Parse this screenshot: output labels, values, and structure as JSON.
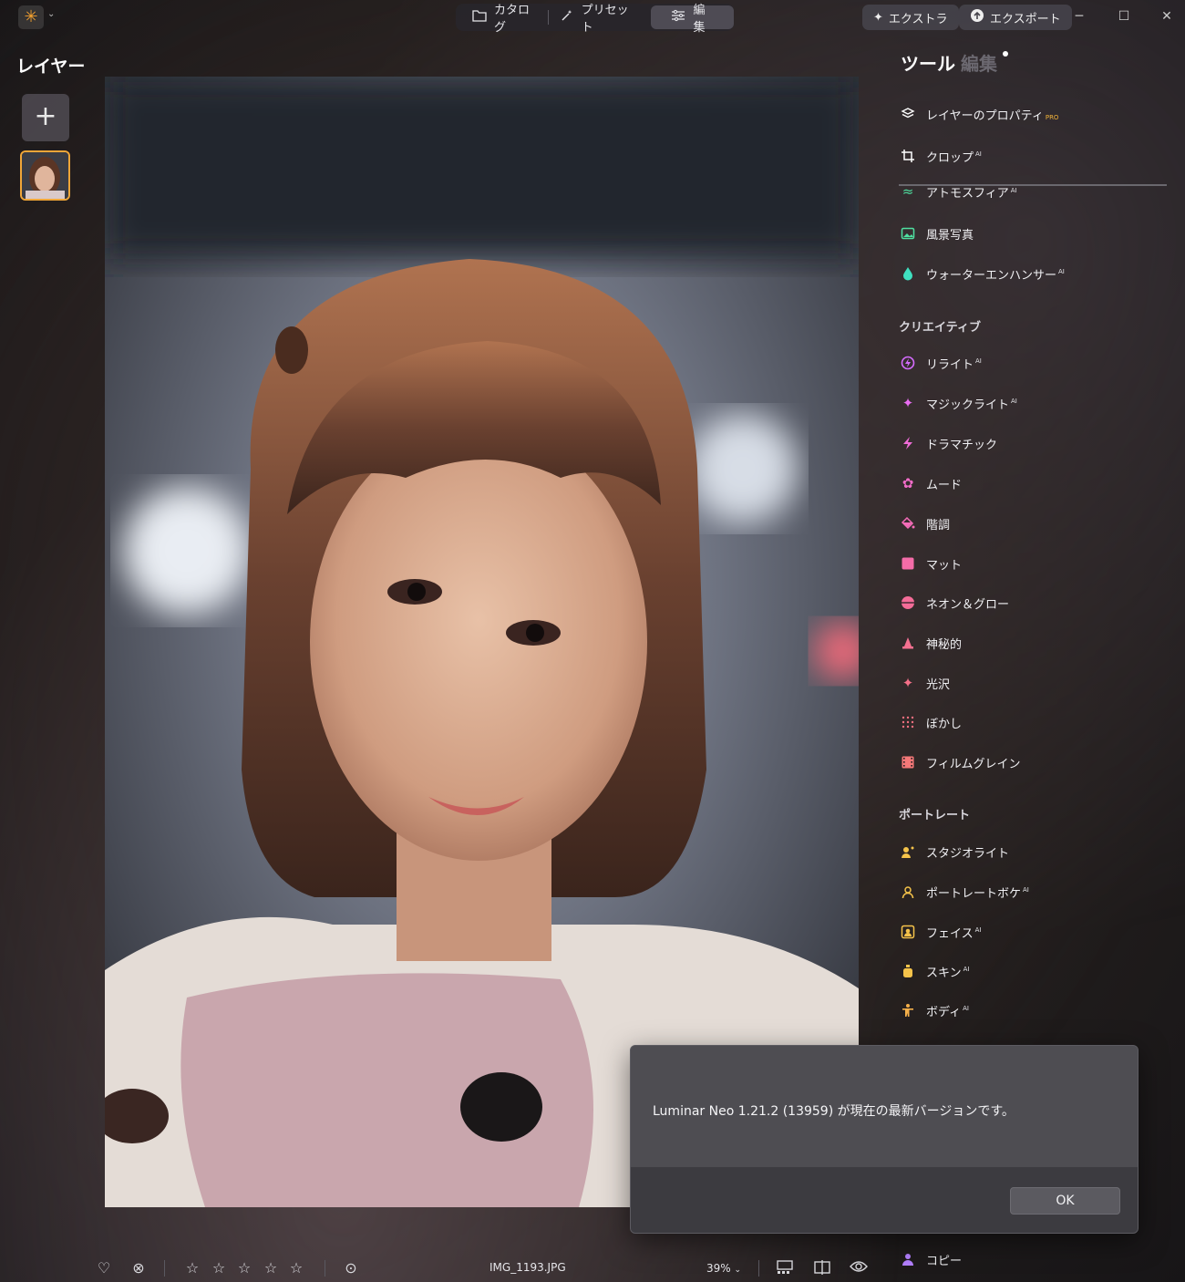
{
  "titlebar": {
    "modes": [
      {
        "label": "カタログ",
        "icon": "folder-icon"
      },
      {
        "label": "プリセット",
        "icon": "sparkle-wand-icon"
      },
      {
        "label": "編集",
        "icon": "sliders-icon",
        "active": true
      }
    ],
    "extras_label": "エクストラ",
    "export_label": "エクスポート"
  },
  "layers": {
    "title": "レイヤー",
    "add_symbol": "+"
  },
  "panel": {
    "tab_tools": "ツール",
    "tab_edits": "編集",
    "top_items": [
      {
        "label": "レイヤーのプロパティ",
        "badge": "PRO",
        "icon": "layers-icon",
        "color": "#ffffff"
      },
      {
        "label": "クロップ",
        "badge": "AI",
        "icon": "crop-icon",
        "color": "#ffffff"
      }
    ],
    "scrolled_items": [
      {
        "label": "アトモスフィア",
        "badge": "AI",
        "icon": "atmosphere-icon",
        "color": "#4fe0a0"
      },
      {
        "label": "風景写真",
        "badge": "",
        "icon": "landscape-icon",
        "color": "#4fe0a0"
      },
      {
        "label": "ウォーターエンハンサー",
        "badge": "AI",
        "icon": "water-drop-icon",
        "color": "#3fe0c0"
      }
    ],
    "creative_title": "クリエイティブ",
    "creative_items": [
      {
        "label": "リライト",
        "badge": "AI",
        "icon": "relight-icon",
        "color": "#d66cff"
      },
      {
        "label": "マジックライト",
        "badge": "AI",
        "icon": "magic-light-icon",
        "color": "#e86cf0"
      },
      {
        "label": "ドラマチック",
        "badge": "",
        "icon": "lightning-icon",
        "color": "#f06cd8"
      },
      {
        "label": "ムード",
        "badge": "",
        "icon": "lotus-icon",
        "color": "#f06cc8"
      },
      {
        "label": "階調",
        "badge": "",
        "icon": "paint-bucket-icon",
        "color": "#f46cb8"
      },
      {
        "label": "マット",
        "badge": "",
        "icon": "square-icon",
        "color": "#f46ca8"
      },
      {
        "label": "ネオン＆グロー",
        "badge": "",
        "icon": "neon-icon",
        "color": "#f46c98"
      },
      {
        "label": "神秘的",
        "badge": "",
        "icon": "mystic-icon",
        "color": "#f47090"
      },
      {
        "label": "光沢",
        "badge": "",
        "icon": "glow-sparkle-icon",
        "color": "#f47088"
      },
      {
        "label": "ぼかし",
        "badge": "",
        "icon": "blur-icon",
        "color": "#f47080"
      },
      {
        "label": "フィルムグレイン",
        "badge": "",
        "icon": "film-icon",
        "color": "#f47878"
      }
    ],
    "portrait_title": "ポートレート",
    "portrait_items": [
      {
        "label": "スタジオライト",
        "badge": "",
        "icon": "studio-light-icon",
        "color": "#f5c34a"
      },
      {
        "label": "ポートレートボケ",
        "badge": "AI",
        "icon": "portrait-bokeh-icon",
        "color": "#f5c34a"
      },
      {
        "label": "フェイス",
        "badge": "AI",
        "icon": "face-icon",
        "color": "#f5c34a"
      },
      {
        "label": "スキン",
        "badge": "AI",
        "icon": "skin-icon",
        "color": "#f5c34a"
      },
      {
        "label": "ボディ",
        "badge": "AI",
        "icon": "body-icon",
        "color": "#f5b04a"
      }
    ],
    "copy_label": "コピー"
  },
  "bottombar": {
    "filename": "IMG_1193.JPG",
    "zoom": "39%",
    "rating_stars": 5
  },
  "dialog": {
    "message": "Luminar Neo 1.21.2 (13959) が現在の最新バージョンです。",
    "ok_label": "OK"
  },
  "colors": {
    "accent": "#f0a638",
    "creative": "#e86cf0",
    "portrait": "#f5c34a",
    "landscape": "#4fe0a0"
  }
}
